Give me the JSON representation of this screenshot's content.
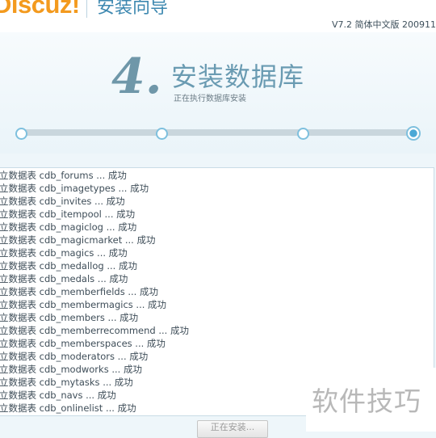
{
  "header": {
    "logo": "Discuz!",
    "title": "安装向导",
    "version": "V7.2 简体中文版 200911"
  },
  "step": {
    "number": "4.",
    "title": "安装数据库",
    "subtitle": "正在执行数据库安装"
  },
  "progress": {
    "total_steps": 4,
    "current_step": 4
  },
  "log": {
    "lines": [
      "立数据表 cdb_forums ... 成功",
      "立数据表 cdb_imagetypes ... 成功",
      "立数据表 cdb_invites ... 成功",
      "立数据表 cdb_itempool ... 成功",
      "立数据表 cdb_magiclog ... 成功",
      "立数据表 cdb_magicmarket ... 成功",
      "立数据表 cdb_magics ... 成功",
      "立数据表 cdb_medallog ... 成功",
      "立数据表 cdb_medals ... 成功",
      "立数据表 cdb_memberfields ... 成功",
      "立数据表 cdb_membermagics ... 成功",
      "立数据表 cdb_members ... 成功",
      "立数据表 cdb_memberrecommend ... 成功",
      "立数据表 cdb_memberspaces ... 成功",
      "立数据表 cdb_moderators ... 成功",
      "立数据表 cdb_modworks ... 成功",
      "立数据表 cdb_mytasks ... 成功",
      "立数据表 cdb_navs ... 成功",
      "立数据表 cdb_onlinelist ... 成功"
    ]
  },
  "button": {
    "label": "正在安装..."
  },
  "watermark": {
    "text": "软件技巧"
  },
  "colors": {
    "logo": "#f39a1e",
    "accent": "#3d88b0",
    "step_dot": "#7ec0de"
  }
}
